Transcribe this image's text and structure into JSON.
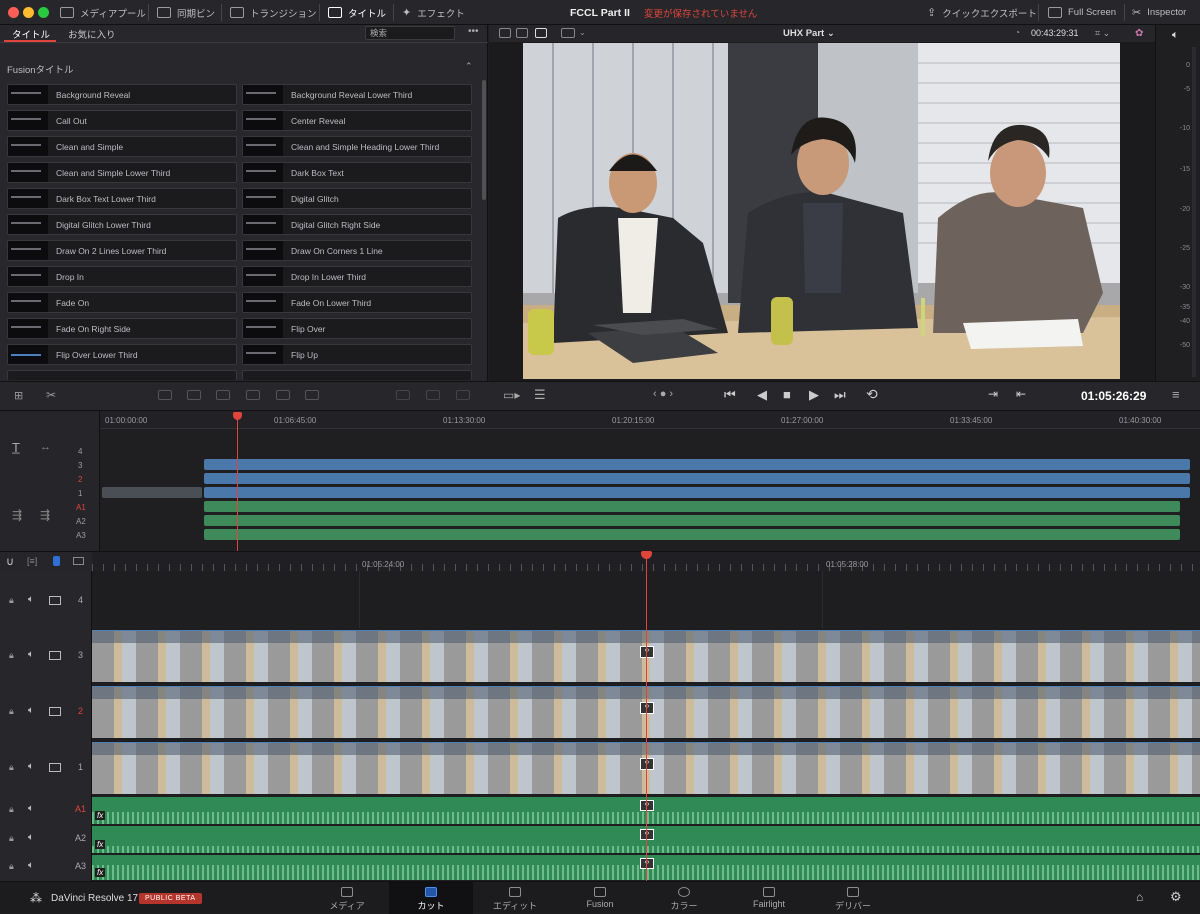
{
  "window": {
    "project_title": "FCCL Part II",
    "unsaved_notice": "変更が保存されていません"
  },
  "toolbar": {
    "media_pool": "メディアプール",
    "sync_bin": "同期ビン",
    "transitions": "トランジション",
    "titles": "タイトル",
    "effects": "エフェクト",
    "quick_export": "クイックエクスポート",
    "full_screen": "Full Screen",
    "inspector": "Inspector"
  },
  "left_panel": {
    "tab_titles": "タイトル",
    "tab_favorites": "お気に入り",
    "search_placeholder": "検索",
    "section_title": "Fusionタイトル",
    "items": [
      "Background Reveal",
      "Background Reveal Lower Third",
      "Call Out",
      "Center Reveal",
      "Clean and Simple",
      "Clean and Simple Heading Lower Third",
      "Clean and Simple Lower Third",
      "Dark Box Text",
      "Dark Box Text Lower Third",
      "Digital Glitch",
      "Digital Glitch Lower Third",
      "Digital Glitch Right Side",
      "Draw On 2 Lines Lower Third",
      "Draw On Corners 1 Line",
      "Drop In",
      "Drop In Lower Third",
      "Fade On",
      "Fade On Lower Third",
      "Fade On Right Side",
      "Flip Over",
      "Flip Over Lower Third",
      "Flip Up"
    ]
  },
  "viewer": {
    "timeline_name": "UHX Part",
    "duration": "00:43:29:31",
    "timecode": "01:05:26:29"
  },
  "meter": {
    "ticks": [
      "0",
      "-5",
      "-10",
      "-15",
      "-20",
      "-25",
      "-30",
      "-35",
      "-40",
      "-50"
    ]
  },
  "overview_timeline": {
    "ruler": [
      "01:00:00:00",
      "01:06:45:00",
      "01:13:30:00",
      "01:20:15:00",
      "01:27:00:00",
      "01:33:45:00",
      "01:40:30:00"
    ],
    "tracks": [
      "4",
      "3",
      "2",
      "1",
      "A1",
      "A2",
      "A3"
    ]
  },
  "detail_timeline": {
    "ruler": [
      "01:05:24:00",
      "01:05:28:00"
    ],
    "video_tracks": [
      "4",
      "3",
      "2",
      "1"
    ],
    "audio_tracks": [
      "A1",
      "A2",
      "A3"
    ],
    "fx_label": "fx"
  },
  "bottom_bar": {
    "app_name": "DaVinci Resolve 17",
    "badge": "PUBLIC BETA",
    "pages": [
      "メディア",
      "カット",
      "エディット",
      "Fusion",
      "カラー",
      "Fairlight",
      "デリバー"
    ]
  },
  "colors": {
    "accent_red": "#e0443a",
    "video_clip_blue": "#4a78aa",
    "audio_clip_green": "#2f8a55"
  }
}
